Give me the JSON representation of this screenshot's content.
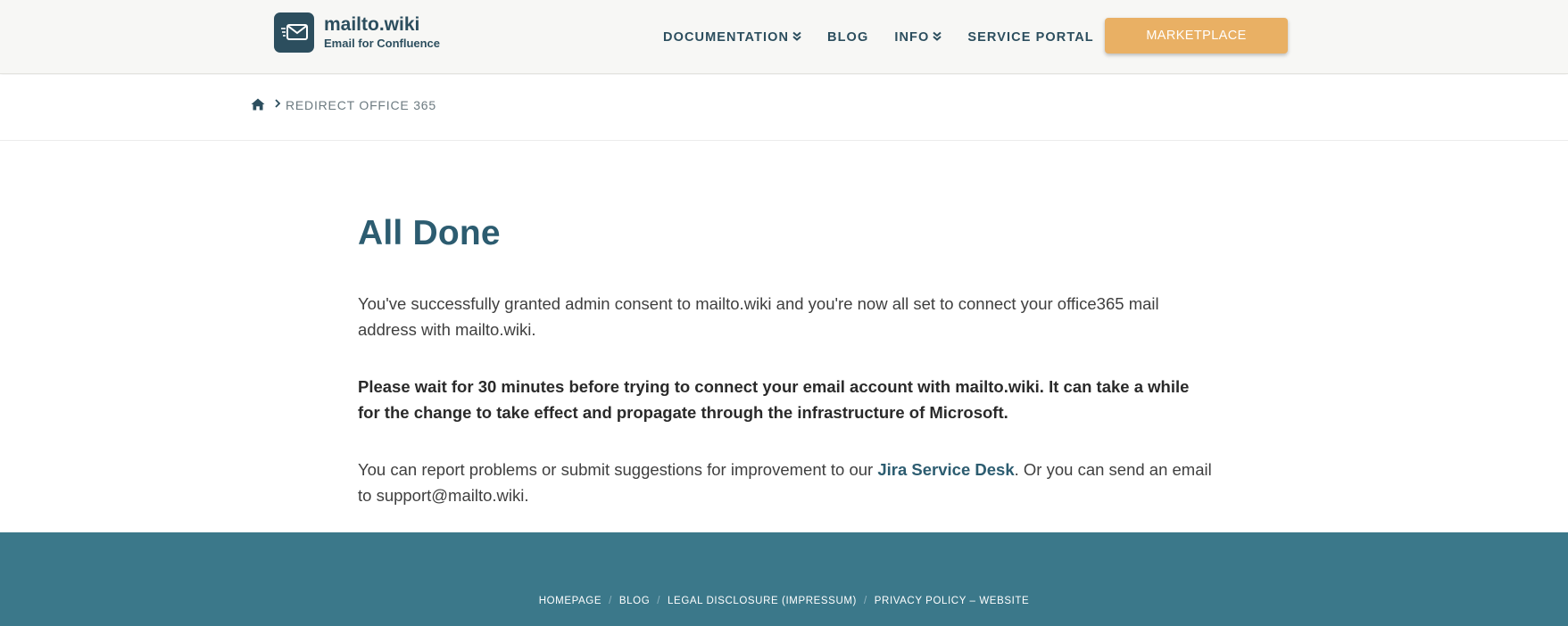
{
  "header": {
    "logo_title": "mailto.wiki",
    "logo_subtitle": "Email for Confluence",
    "logo_icon": "envelope-icon",
    "nav": [
      {
        "label": "DOCUMENTATION",
        "has_dropdown": true
      },
      {
        "label": "BLOG",
        "has_dropdown": false
      },
      {
        "label": "INFO",
        "has_dropdown": true
      },
      {
        "label": "SERVICE PORTAL",
        "has_dropdown": false
      }
    ],
    "cta_label": "MARKETPLACE"
  },
  "breadcrumb": {
    "home_icon": "home-icon",
    "separator_icon": "chevron-right-icon",
    "current": "REDIRECT OFFICE 365"
  },
  "main": {
    "title": "All Done",
    "para1": "You've successfully granted admin consent to mailto.wiki and you're now all set to connect your office365 mail address with mailto.wiki.",
    "para2": "Please wait for 30 minutes before trying to connect your email account with mailto.wiki. It can take a while for the change to take effect and propagate through the infrastructure of Microsoft.",
    "para3_before": "You can report problems or submit suggestions for improvement to our ",
    "para3_link": "Jira Service Desk",
    "para3_after": ". Or you can send an email to support@mailto.wiki."
  },
  "footer": {
    "links": [
      "HOMEPAGE",
      "BLOG",
      "LEGAL DISCLOSURE (IMPRESSUM)",
      "PRIVACY POLICY – WEBSITE"
    ],
    "separator": "/"
  },
  "colors": {
    "brand_dark": "#2c4e5e",
    "heading": "#2c5c70",
    "cta": "#e9b064",
    "footer_bg": "#3b788a"
  }
}
